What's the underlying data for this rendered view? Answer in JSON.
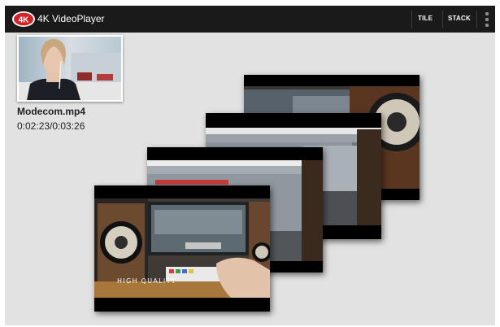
{
  "app": {
    "logo_text": "4K",
    "title": "4K VideoPlayer"
  },
  "actionbar": {
    "tile_label": "TILE",
    "stack_label": "STACK",
    "overflow_icon": "overflow-menu-icon"
  },
  "video": {
    "name": "Modecom.mp4",
    "time": "0:02:23/0:03:26"
  },
  "stack": {
    "caption": "HIGH QUALITY"
  },
  "colors": {
    "actionbar": "#1a1a1a",
    "background": "#e2e2e2",
    "logo_red": "#d0232a"
  }
}
